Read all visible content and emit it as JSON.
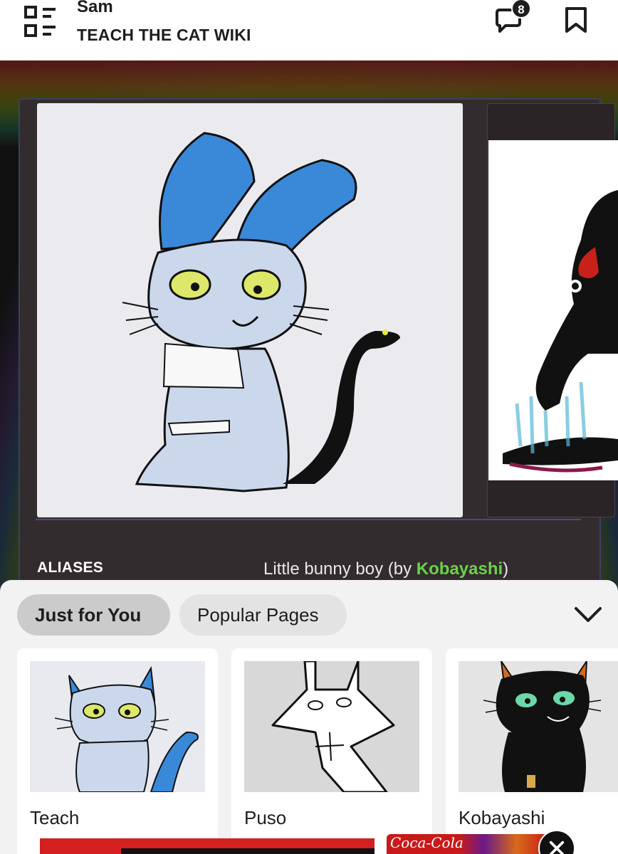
{
  "header": {
    "user_name": "Sam",
    "wiki_name": "TEACH THE CAT WIKI",
    "notification_count": "8"
  },
  "infobox": {
    "aliases_label": "ALIASES",
    "aliases_value_prefix": "Little bunny boy (by ",
    "aliases_value_link": "Kobayashi",
    "aliases_value_suffix": ")"
  },
  "recommendations": {
    "tabs": [
      {
        "label": "Just for You",
        "active": true
      },
      {
        "label": "Popular Pages",
        "active": false
      }
    ],
    "cards": [
      {
        "title": "Teach"
      },
      {
        "title": "Puso"
      },
      {
        "title": "Kobayashi"
      }
    ]
  },
  "ad": {
    "brand_text": "Coca-Cola"
  },
  "colors": {
    "link_green": "#6cd04a",
    "infobox_bg": "#332c2e",
    "sheet_bg": "#f2f2f2"
  }
}
